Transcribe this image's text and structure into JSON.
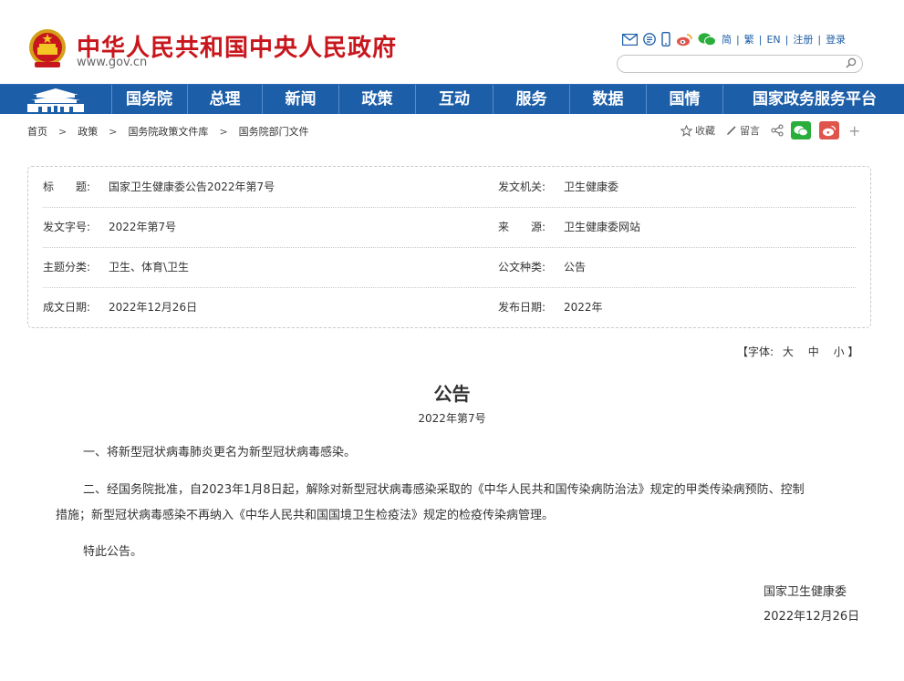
{
  "header": {
    "site_name": "中华人民共和国中央人民政府",
    "site_url": "www.gov.cn",
    "emblem_icon": "national-emblem-icon",
    "tools": {
      "icons": [
        "mail-icon",
        "rss-icon",
        "mobile-icon",
        "weibo-icon",
        "wechat-icon"
      ],
      "links": [
        "简",
        "繁",
        "EN",
        "注册",
        "登录"
      ]
    },
    "search": {
      "placeholder": "",
      "value": ""
    }
  },
  "nav": {
    "home_icon": "tiananmen-icon",
    "items": [
      "国务院",
      "总理",
      "新闻",
      "政策",
      "互动",
      "服务",
      "数据",
      "国情",
      "国家政务服务平台"
    ]
  },
  "breadcrumb": [
    "首页",
    "政策",
    "国务院政策文件库",
    "国务院部门文件"
  ],
  "share": {
    "collect": "收藏",
    "comment": "留言",
    "icons": [
      "star-icon",
      "pen-icon",
      "share-icon",
      "wechat-icon",
      "weibo-icon",
      "plus-icon"
    ]
  },
  "info": {
    "title_label": "标　　题:",
    "title_value": "国家卫生健康委公告2022年第7号",
    "issuer_label": "发文机关:",
    "issuer_value": "卫生健康委",
    "docno_label": "发文字号:",
    "docno_value": "2022年第7号",
    "source_label": "来　　源:",
    "source_value": "卫生健康委网站",
    "topic_label": "主题分类:",
    "topic_value": "卫生、体育\\卫生",
    "type_label": "公文种类:",
    "type_value": "公告",
    "date_label": "成文日期:",
    "date_value": "2022年12月26日",
    "pubdate_label": "发布日期:",
    "pubdate_value": "2022年"
  },
  "fontsize": {
    "open": "【字体:",
    "big": "大",
    "mid": "中",
    "small": "小",
    "close": "】"
  },
  "article": {
    "title": "公告",
    "docno": "2022年第7号",
    "p1": "一、将新型冠状病毒肺炎更名为新型冠状病毒感染。",
    "p2_line1": "二、经国务院批准，自2023年1月8日起，解除对新型冠状病毒感染采取的《中华人民共和国传染病防治法》规定的甲类传染病预防、控制",
    "p2_line2": "措施；新型冠状病毒感染不再纳入《中华人民共和国国境卫生检疫法》规定的检疫传染病管理。",
    "p3": "特此公告。",
    "sign_org": "国家卫生健康委",
    "sign_date": "2022年12月26日"
  },
  "colors": {
    "brand_red": "#c8161d",
    "nav_blue": "#1d5ea8",
    "wechat_green": "#2aae3b",
    "weibo_red": "#e0554b"
  }
}
